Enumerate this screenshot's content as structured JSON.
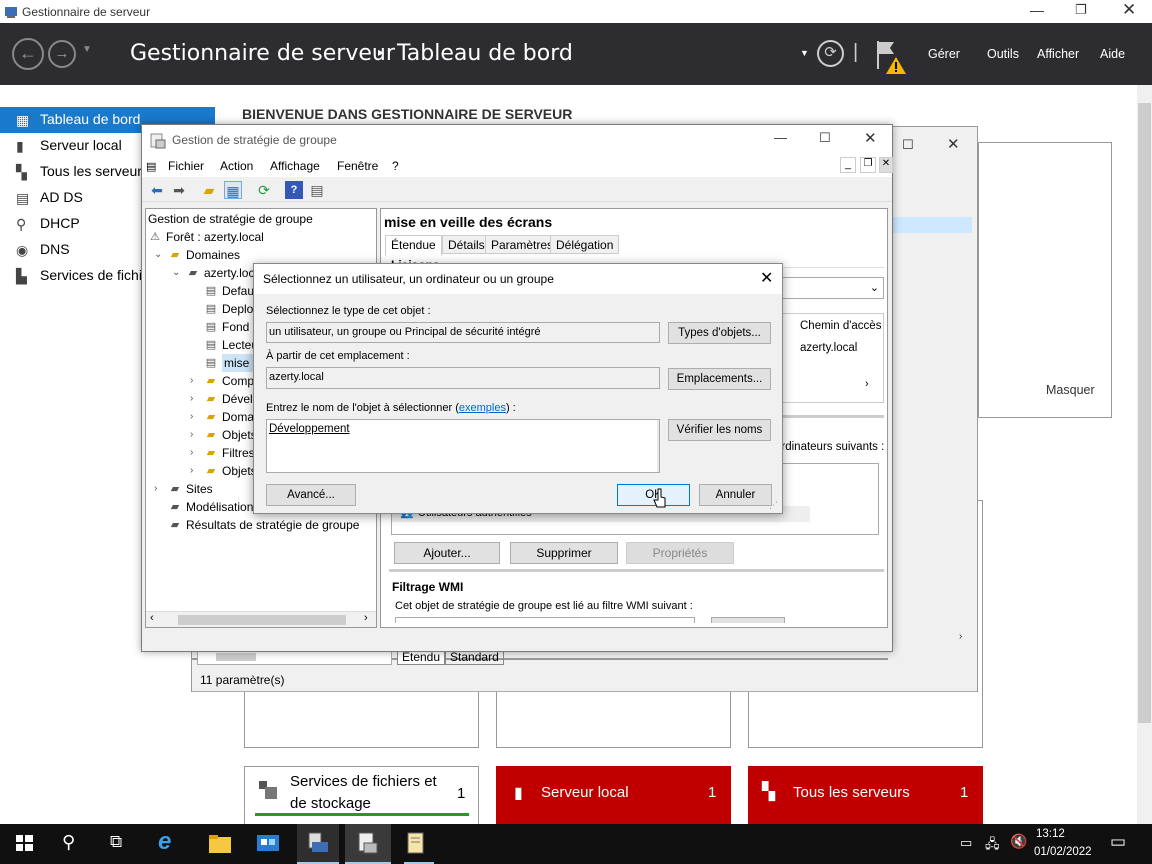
{
  "server_manager": {
    "window_title": "Gestionnaire de serveur",
    "breadcrumb_root": "Gestionnaire de serveur",
    "breadcrumb_sep": "▸",
    "breadcrumb_page": "Tableau de bord",
    "menu": [
      "Gérer",
      "Outils",
      "Afficher",
      "Aide"
    ],
    "nav": [
      {
        "label": "Tableau de bord",
        "icon": "dashboard-icon",
        "selected": true
      },
      {
        "label": "Serveur local",
        "icon": "server-icon"
      },
      {
        "label": "Tous les serveurs",
        "icon": "servers-icon"
      },
      {
        "label": "AD DS",
        "icon": "adds-icon"
      },
      {
        "label": "DHCP",
        "icon": "dhcp-icon"
      },
      {
        "label": "DNS",
        "icon": "dns-icon"
      },
      {
        "label": "Services de fichiers",
        "icon": "files-icon"
      }
    ],
    "welcome": "BIENVENUE DANS GESTIONNAIRE DE SERVEUR",
    "hide_label": "Masquer",
    "tiles": [
      {
        "label1": "Services de fichiers et",
        "label2": "de stockage",
        "count": "1",
        "status": "ok"
      },
      {
        "label": "Serveur local",
        "count": "1",
        "status": "alert"
      },
      {
        "label": "Tous les serveurs",
        "count": "1",
        "status": "alert"
      }
    ],
    "colors": {
      "header": "#2d2d30",
      "selected": "#1979ca",
      "alert": "#c00000",
      "ok_bar": "#1ea01e"
    }
  },
  "background_window": {
    "tabs": [
      "Étendu",
      "Standard"
    ],
    "status": "11 paramètre(s)",
    "col_header": "Chemin d'accès",
    "col_value": "azerty.local",
    "partial_text": "ordinateurs suivants :"
  },
  "gpm": {
    "title": "Gestion de stratégie de groupe",
    "menu": [
      "Fichier",
      "Action",
      "Affichage",
      "Fenêtre",
      "?"
    ],
    "tree": [
      {
        "label": "Gestion de stratégie de groupe",
        "depth": 0,
        "expander": ""
      },
      {
        "label": "Forêt : azerty.local",
        "depth": 0,
        "expander": ""
      },
      {
        "label": "Domaines",
        "depth": 1,
        "expander": "v"
      },
      {
        "label": "azerty.local",
        "depth": 2,
        "expander": "v"
      },
      {
        "label": "Default",
        "depth": 3,
        "expander": ""
      },
      {
        "label": "Deploy",
        "depth": 3,
        "expander": ""
      },
      {
        "label": "Fond",
        "depth": 3,
        "expander": ""
      },
      {
        "label": "Lecteur",
        "depth": 3,
        "expander": ""
      },
      {
        "label": "mise en veille des écrans",
        "depth": 3,
        "expander": "",
        "selected": true
      },
      {
        "label": "Computers",
        "depth": 3,
        "expander": ">"
      },
      {
        "label": "Développement",
        "depth": 3,
        "expander": ">"
      },
      {
        "label": "Domain Controllers",
        "depth": 3,
        "expander": ">"
      },
      {
        "label": "Objets",
        "depth": 3,
        "expander": ">"
      },
      {
        "label": "Filtres",
        "depth": 3,
        "expander": ">"
      },
      {
        "label": "Objets",
        "depth": 3,
        "expander": ">"
      },
      {
        "label": "Sites",
        "depth": 1,
        "expander": ">"
      },
      {
        "label": "Modélisation",
        "depth": 1,
        "expander": ""
      },
      {
        "label": "Résultats de stratégie de groupe",
        "depth": 1,
        "expander": ""
      }
    ],
    "detail_title": "mise en veille des écrans",
    "detail_tabs": [
      "Étendue",
      "Détails",
      "Paramètres",
      "Délégation"
    ],
    "link_heading": "Liaisons",
    "auth_users": "Utilisateurs authentifiés",
    "buttons": {
      "add": "Ajouter...",
      "remove": "Supprimer",
      "properties": "Propriétés"
    },
    "wmi_heading": "Filtrage WMI",
    "wmi_text": "Cet objet de stratégie de groupe est lié au filtre WMI suivant :"
  },
  "dialog": {
    "title": "Sélectionnez un utilisateur, un ordinateur ou un groupe",
    "type_label": "Sélectionnez le type de cet objet :",
    "type_value": "un utilisateur, un groupe ou Principal de sécurité intégré",
    "type_button": "Types d'objets...",
    "location_label": "À partir de cet emplacement :",
    "location_value": "azerty.local",
    "location_button": "Emplacements...",
    "name_label_pre": "Entrez le nom de l'objet à sélectionner (",
    "name_label_link": "exemples",
    "name_label_post": ") :",
    "name_value": "Développement",
    "check_button": "Vérifier les noms",
    "advanced_button": "Avancé...",
    "ok_button": "OK",
    "cancel_button": "Annuler"
  },
  "taskbar": {
    "time": "13:12",
    "date": "01/02/2022"
  }
}
